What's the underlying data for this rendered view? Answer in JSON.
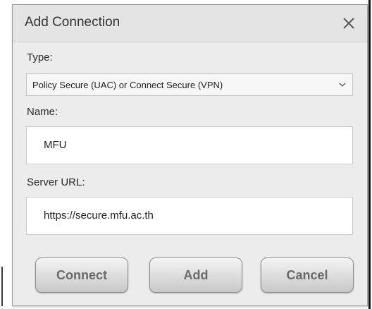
{
  "dialog": {
    "title": "Add Connection",
    "close_icon": "close-x-icon"
  },
  "type_field": {
    "label": "Type:",
    "selected_value": "Policy Secure (UAC) or Connect Secure (VPN)",
    "dropdown_icon": "chevron-down-icon"
  },
  "name_field": {
    "label": "Name:",
    "value": "MFU"
  },
  "server_url_field": {
    "label": "Server URL:",
    "value": "https://secure.mfu.ac.th"
  },
  "buttons": {
    "connect": "Connect",
    "add": "Add",
    "cancel": "Cancel"
  }
}
